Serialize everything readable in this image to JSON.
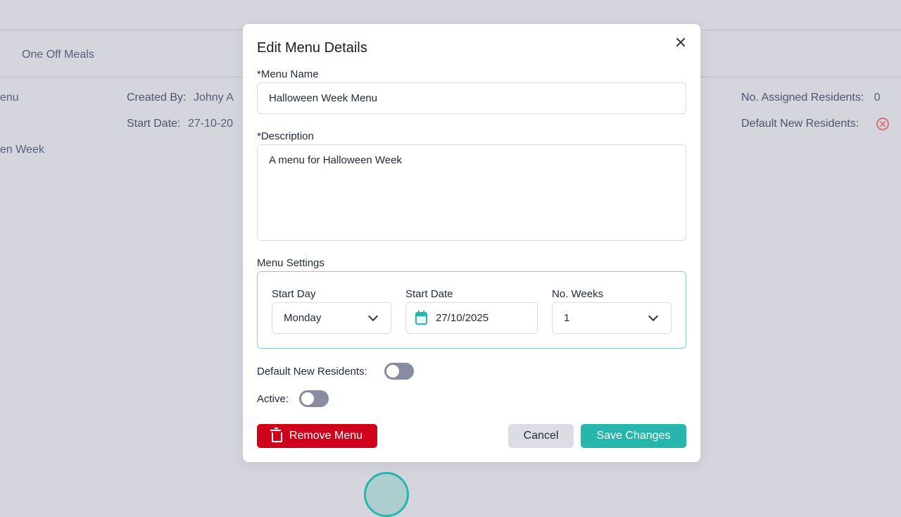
{
  "background": {
    "tab_one_off_meals": "One Off Meals",
    "menu_fragment": "enu",
    "week_fragment": "en Week",
    "created_by_label": "Created By:",
    "created_by_value": "Johny A",
    "start_date_label": "Start Date:",
    "start_date_value": "27-10-20",
    "assigned_label": "No. Assigned Residents:",
    "assigned_value": "0",
    "default_new_label": "Default New Residents:",
    "default_icon": "x-circle-icon"
  },
  "modal": {
    "title": "Edit Menu Details",
    "close_icon": "close-icon",
    "menu_name_label": "*Menu Name",
    "menu_name_value": "Halloween Week Menu",
    "description_label": "*Description",
    "description_value": "A menu for Halloween Week",
    "settings_label": "Menu Settings",
    "start_day_label": "Start Day",
    "start_day_value": "Monday",
    "start_date_label": "Start Date",
    "start_date_value": "27/10/2025",
    "weeks_label": "No. Weeks",
    "weeks_value": "1",
    "default_new_residents_label": "Default New Residents:",
    "default_new_residents_on": false,
    "active_label": "Active:",
    "active_on": false,
    "remove_button": "Remove Menu",
    "cancel_button": "Cancel",
    "save_button": "Save Changes"
  },
  "colors": {
    "accent": "#26b6ac",
    "danger": "#d0021b",
    "toggle_off": "#898ca0",
    "overlay": "#d4d5dd"
  }
}
